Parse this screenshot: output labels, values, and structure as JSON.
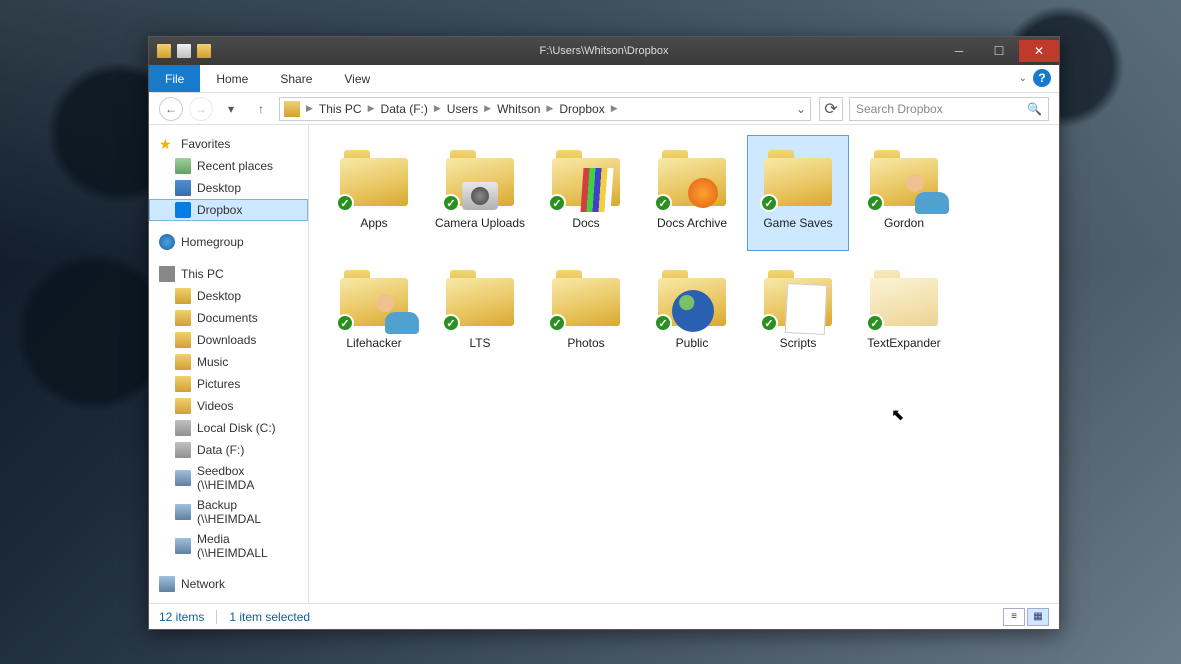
{
  "titlebar": {
    "path": "F:\\Users\\Whitson\\Dropbox"
  },
  "ribbon": {
    "file": "File",
    "home": "Home",
    "share": "Share",
    "view": "View"
  },
  "breadcrumb": {
    "items": [
      "This PC",
      "Data (F:)",
      "Users",
      "Whitson",
      "Dropbox"
    ]
  },
  "search": {
    "placeholder": "Search Dropbox"
  },
  "sidebar": {
    "favorites": {
      "title": "Favorites",
      "items": [
        "Recent places",
        "Desktop",
        "Dropbox"
      ]
    },
    "homegroup": {
      "title": "Homegroup"
    },
    "thispc": {
      "title": "This PC",
      "items": [
        "Desktop",
        "Documents",
        "Downloads",
        "Music",
        "Pictures",
        "Videos",
        "Local Disk (C:)",
        "Data (F:)",
        "Seedbox (\\\\HEIMDA",
        "Backup (\\\\HEIMDAL",
        "Media (\\\\HEIMDALL"
      ]
    },
    "network": {
      "title": "Network"
    }
  },
  "folders": [
    {
      "name": "Apps",
      "overlay": "none"
    },
    {
      "name": "Camera Uploads",
      "overlay": "camera"
    },
    {
      "name": "Docs",
      "overlay": "docs"
    },
    {
      "name": "Docs Archive",
      "overlay": "ff"
    },
    {
      "name": "Game Saves",
      "overlay": "none",
      "selected": true
    },
    {
      "name": "Gordon",
      "overlay": "person"
    },
    {
      "name": "Lifehacker",
      "overlay": "person"
    },
    {
      "name": "LTS",
      "overlay": "none"
    },
    {
      "name": "Photos",
      "overlay": "none"
    },
    {
      "name": "Public",
      "overlay": "globe"
    },
    {
      "name": "Scripts",
      "overlay": "script"
    },
    {
      "name": "TextExpander",
      "overlay": "none"
    }
  ],
  "status": {
    "count": "12 items",
    "selection": "1 item selected"
  }
}
